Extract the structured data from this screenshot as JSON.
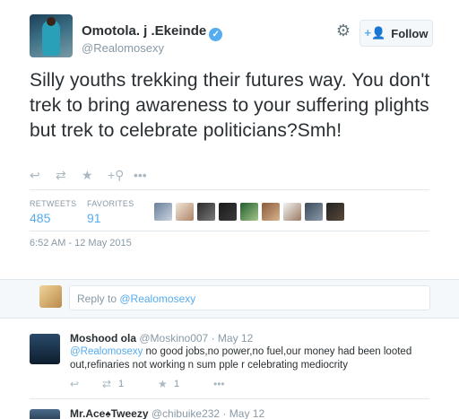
{
  "tweet": {
    "author_name": "Omotola. j .Ekeinde",
    "verified_glyph": "✓",
    "author_handle": "@Realomosexy",
    "follow_label": "Follow",
    "text": "Silly youths trekking their futures way. You don't trek to bring awareness to your suffering plights but trek to celebrate politicians?Smh!",
    "actions": [
      "reply-icon",
      "retweet-icon",
      "favorite-icon",
      "follow-icon",
      "more-icon"
    ],
    "stats": {
      "retweets_label": "RETWEETS",
      "retweets": "485",
      "favorites_label": "FAVORITES",
      "favorites": "91"
    },
    "favoriter_avatars": 9,
    "timestamp": "6:52 AM - 12 May 2015"
  },
  "reply_box": {
    "prefix": "Reply to ",
    "mention": "@Realomosexy"
  },
  "replies": [
    {
      "name": "Moshood ola",
      "handle": "@Moskino007",
      "sep": " · ",
      "date": "May 12",
      "mention": "@Realomosexy",
      "text": "  no good jobs,no power,no fuel,our money had been looted out,refinaries not working n sum pple r celebrating mediocrity",
      "retweets": "1",
      "favorites": "1"
    },
    {
      "name": "Mr.Ace♠Tweezy",
      "handle": "@chibuike232",
      "sep": " · ",
      "date": "May 12"
    }
  ],
  "colors": {
    "accent": "#55acee",
    "text": "#292f33",
    "muted": "#8899a6"
  }
}
